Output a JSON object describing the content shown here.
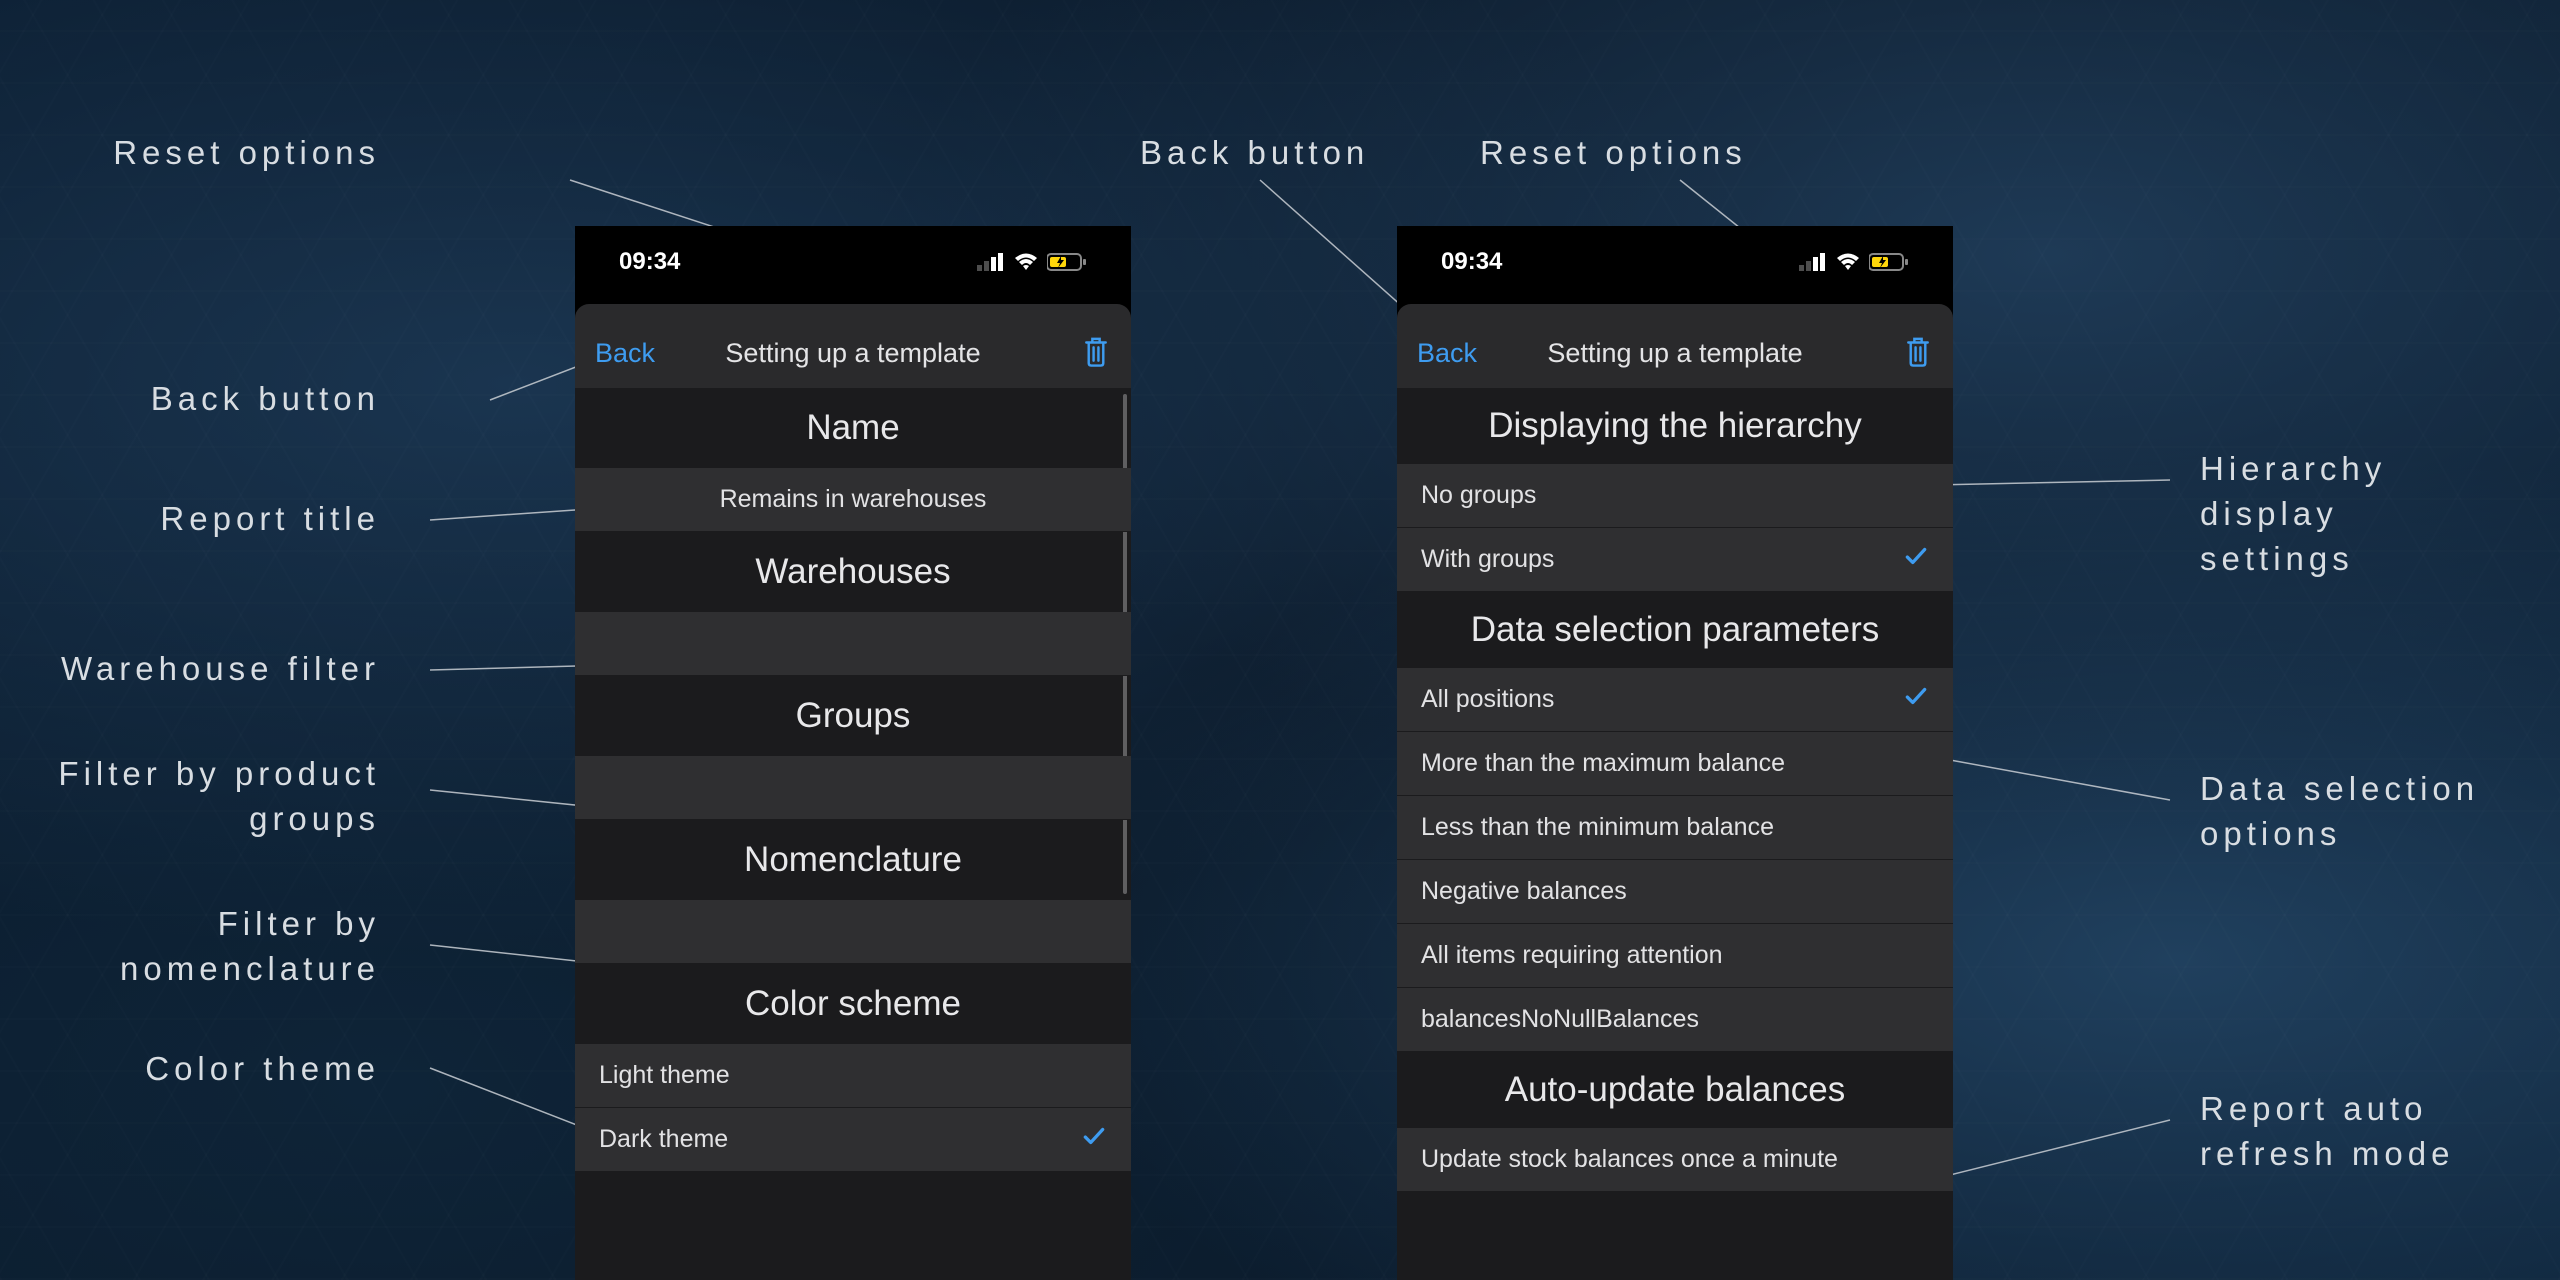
{
  "status": {
    "time": "09:34"
  },
  "nav": {
    "back_label": "Back",
    "title": "Setting up a template",
    "trash_icon": "trash-icon"
  },
  "phone1": {
    "sections": {
      "name": {
        "header": "Name",
        "value": "Remains in warehouses"
      },
      "warehouses": {
        "header": "Warehouses",
        "value": ""
      },
      "groups": {
        "header": "Groups",
        "value": ""
      },
      "nomenclature": {
        "header": "Nomenclature",
        "value": ""
      },
      "color": {
        "header": "Color scheme",
        "options": [
          {
            "label": "Light theme",
            "checked": false
          },
          {
            "label": "Dark theme",
            "checked": true
          }
        ]
      }
    }
  },
  "phone2": {
    "sections": {
      "hierarchy": {
        "header": "Displaying the hierarchy",
        "options": [
          {
            "label": "No groups",
            "checked": false
          },
          {
            "label": "With groups",
            "checked": true
          }
        ]
      },
      "selection": {
        "header": "Data selection parameters",
        "options": [
          {
            "label": "All positions",
            "checked": true
          },
          {
            "label": "More than the maximum balance",
            "checked": false
          },
          {
            "label": "Less than the minimum balance",
            "checked": false
          },
          {
            "label": "Negative balances",
            "checked": false
          },
          {
            "label": "All items requiring attention",
            "checked": false
          },
          {
            "label": "balancesNoNullBalances",
            "checked": false
          }
        ]
      },
      "autoupdate": {
        "header": "Auto-update balances",
        "options": [
          {
            "label": "Update stock balances once a minute",
            "checked": false
          }
        ]
      }
    }
  },
  "annotations": {
    "back_button": "Back button",
    "reset_options": "Reset options",
    "report_title": "Report title",
    "warehouse_filter": "Warehouse filter",
    "filter_groups_l1": "Filter by product",
    "filter_groups_l2": "groups",
    "filter_nomen_l1": "Filter by",
    "filter_nomen_l2": "nomenclature",
    "color_theme": "Color theme",
    "hierarchy_l1": "Hierarchy",
    "hierarchy_l2": "display",
    "hierarchy_l3": "settings",
    "data_sel_l1": "Data selection",
    "data_sel_l2": "options",
    "auto_l1": "Report auto",
    "auto_l2": "refresh mode"
  }
}
